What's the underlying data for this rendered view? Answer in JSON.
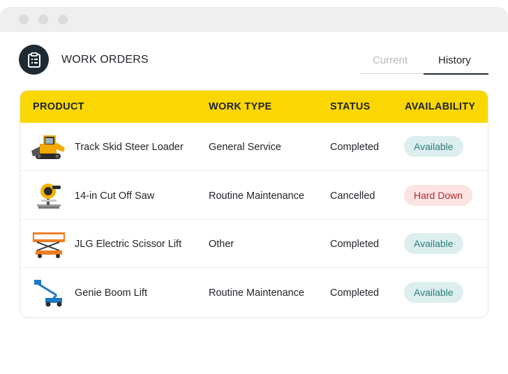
{
  "header": {
    "title": "WORK ORDERS",
    "icon": "clipboard-icon"
  },
  "tabs": [
    {
      "label": "Current",
      "active": false
    },
    {
      "label": "History",
      "active": true
    }
  ],
  "table": {
    "columns": [
      "PRODUCT",
      "WORK TYPE",
      "STATUS",
      "AVAILABILITY"
    ],
    "rows": [
      {
        "product": "Track Skid Steer Loader",
        "work_type": "General Service",
        "status": "Completed",
        "availability": "Available",
        "icon": "skid-steer-loader-image"
      },
      {
        "product": "14-in Cut Off Saw",
        "work_type": "Routine Maintenance",
        "status": "Cancelled",
        "availability": "Hard Down",
        "icon": "cut-off-saw-image"
      },
      {
        "product": "JLG Electric Scissor Lift",
        "work_type": "Other",
        "status": "Completed",
        "availability": "Available",
        "icon": "scissor-lift-image"
      },
      {
        "product": "Genie Boom Lift",
        "work_type": "Routine Maintenance",
        "status": "Completed",
        "availability": "Available",
        "icon": "boom-lift-image"
      }
    ]
  },
  "colors": {
    "header_bg": "#fad700",
    "icon_bg": "#1f2a33",
    "available_bg": "#dcefee",
    "available_text": "#2a7d77",
    "down_bg": "#fbe3e3",
    "down_text": "#b52a2a"
  }
}
